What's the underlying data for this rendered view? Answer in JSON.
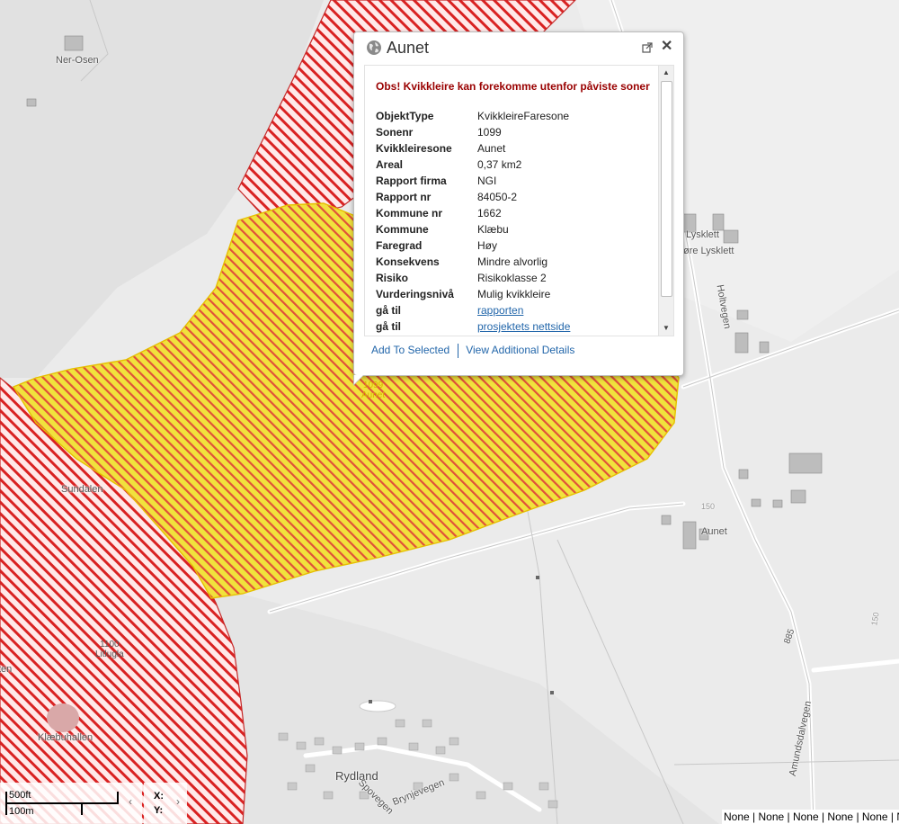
{
  "popup": {
    "title": "Aunet",
    "warning": "Obs! Kvikkleire kan forekomme utenfor påviste soner",
    "attributes": [
      {
        "key": "ObjektType",
        "value": "KvikkleireFaresone"
      },
      {
        "key": "Sonenr",
        "value": "1099"
      },
      {
        "key": "Kvikkleiresone",
        "value": "Aunet"
      },
      {
        "key": "Areal",
        "value": "0,37 km2"
      },
      {
        "key": "Rapport firma",
        "value": "NGI"
      },
      {
        "key": "Rapport nr",
        "value": "84050-2"
      },
      {
        "key": "Kommune nr",
        "value": "1662"
      },
      {
        "key": "Kommune",
        "value": "Klæbu"
      },
      {
        "key": "Faregrad",
        "value": "Høy"
      },
      {
        "key": "Konsekvens",
        "value": "Mindre alvorlig"
      },
      {
        "key": "Risiko",
        "value": "Risikoklasse 2"
      },
      {
        "key": "Vurderingsnivå",
        "value": "Mulig kvikkleire"
      }
    ],
    "links": [
      {
        "key": "gå til",
        "value": "rapporten"
      },
      {
        "key": "gå til",
        "value": "prosjektets nettside"
      }
    ],
    "footer": {
      "add_to_selected": "Add To Selected",
      "view_details": "View Additional Details"
    }
  },
  "map_labels": {
    "ner_osen": "Ner-Osen",
    "lysklett": "Lysklett",
    "ovre_lysklett": "øre Lysklett",
    "holtvegen": "Holtvegen",
    "sundalen": "Sundalen",
    "aunet": "Aunet",
    "zone_1099_number": "1099",
    "zone_1099_name": "Aunet",
    "zone_1100_number": "1100",
    "zone_1100_name": "Litlugla",
    "klaebuhallen": "Klæbuhallen",
    "rydland": "Rydland",
    "brynjevegen": "Brynjevegen",
    "spotvegen": "Spovegen",
    "amundsdalvegen": "Amundsdalvegen",
    "road_885": "885",
    "contour_150a": "150",
    "contour_150b": "150",
    "partial_left": "ten"
  },
  "scalebar": {
    "imperial": "500ft",
    "metric": "100m"
  },
  "coords": {
    "x_label": "X:",
    "y_label": "Y:"
  },
  "statusbar": "None | None | None | None | None | None | None"
}
